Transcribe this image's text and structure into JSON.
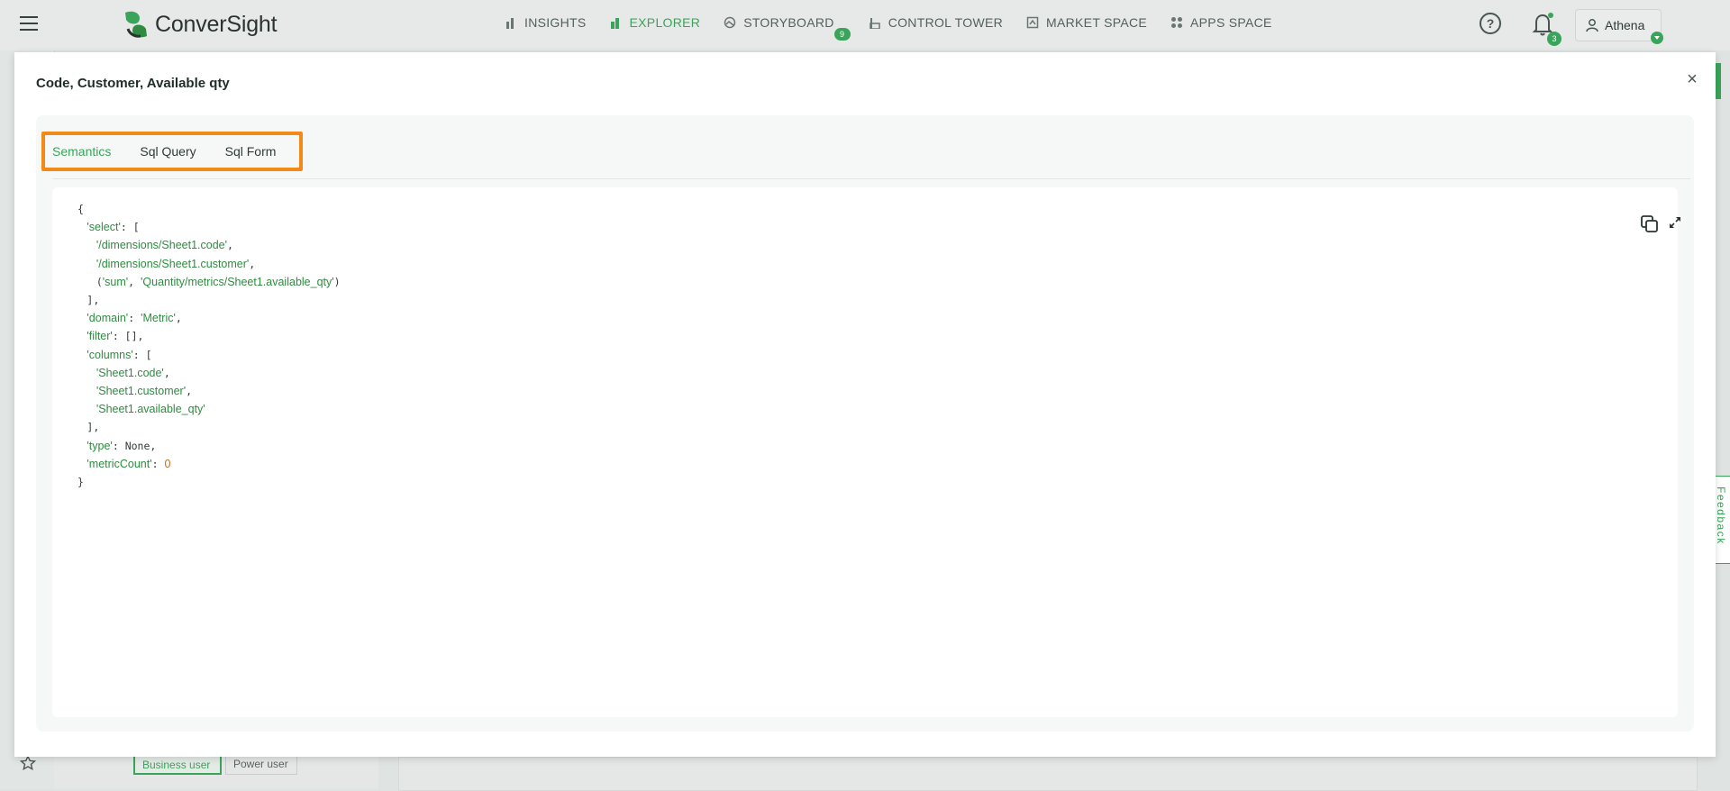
{
  "app": {
    "logo_text": "ConverSight"
  },
  "nav": [
    {
      "label": "INSIGHTS",
      "icon": "bar-chart-icon"
    },
    {
      "label": "EXPLORER",
      "icon": "explorer-bar-icon",
      "active": true
    },
    {
      "label": "STORYBOARD",
      "icon": "storyboard-icon",
      "badge": "9"
    },
    {
      "label": "CONTROL TOWER",
      "icon": "control-tower-icon"
    },
    {
      "label": "MARKET SPACE",
      "icon": "market-space-icon"
    },
    {
      "label": "APPS SPACE",
      "icon": "apps-space-icon"
    }
  ],
  "header": {
    "help_icon": "help-icon",
    "notifications_count": "3",
    "user_name": "Athena"
  },
  "background": {
    "business_user_label": "Business user",
    "power_user_label": "Power user",
    "feedback_label": "Feedback"
  },
  "modal": {
    "title": "Code, Customer, Available qty",
    "close_label": "×",
    "tabs": [
      {
        "label": "Semantics",
        "active": true
      },
      {
        "label": "Sql Query"
      },
      {
        "label": "Sql Form"
      }
    ],
    "code": {
      "open_brace": "{",
      "select_key": "'select'",
      "select_items": [
        "'/dimensions/Sheet1.code'",
        "'/dimensions/Sheet1.customer'"
      ],
      "agg_func": "'sum'",
      "agg_field": "'Quantity/metrics/Sheet1.available_qty'",
      "domain_key": "'domain'",
      "domain_value": "'Metric'",
      "filter_key": "'filter'",
      "filter_value": "[]",
      "columns_key": "'columns'",
      "columns_items": [
        "'Sheet1.code'",
        "'Sheet1.customer'",
        "'Sheet1.available_qty'"
      ],
      "type_key": "'type'",
      "type_value": "None",
      "metric_key": "'metricCount'",
      "metric_value": "0",
      "close_brace": "}"
    }
  },
  "colors": {
    "accent": "#3aa55a",
    "highlight": "#f28a1a"
  }
}
